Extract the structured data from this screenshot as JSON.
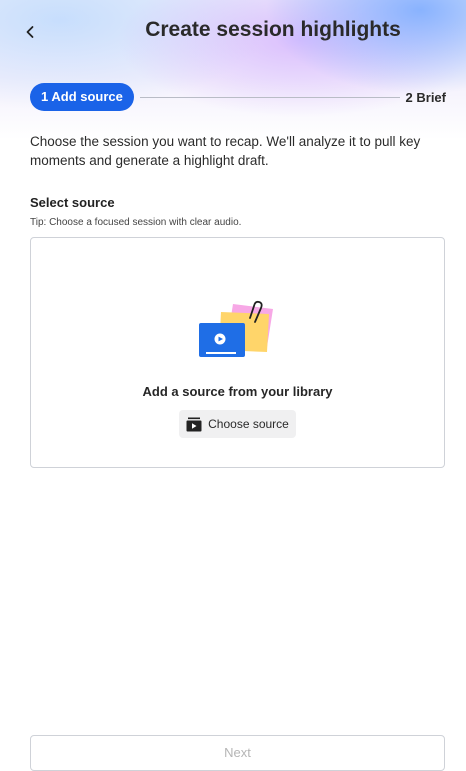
{
  "header": {
    "title": "Create session highlights",
    "back_icon": "chevron-left-icon"
  },
  "stepper": {
    "active_step": "1 Add source",
    "next_step": "2 Brief",
    "active_color": "#1a63e8"
  },
  "description": "Choose the session you want to recap. We'll analyze it to pull key moments and generate a highlight draft.",
  "source": {
    "label": "Select source",
    "tip": "Tip: Choose a focused session with clear audio.",
    "dropzone_title": "Add a source from your library",
    "choose_button_label": "Choose source",
    "choose_button_icon": "video-library-icon",
    "illustration": "source-library-illustration"
  },
  "footer": {
    "next_label": "Next",
    "next_enabled": false
  }
}
